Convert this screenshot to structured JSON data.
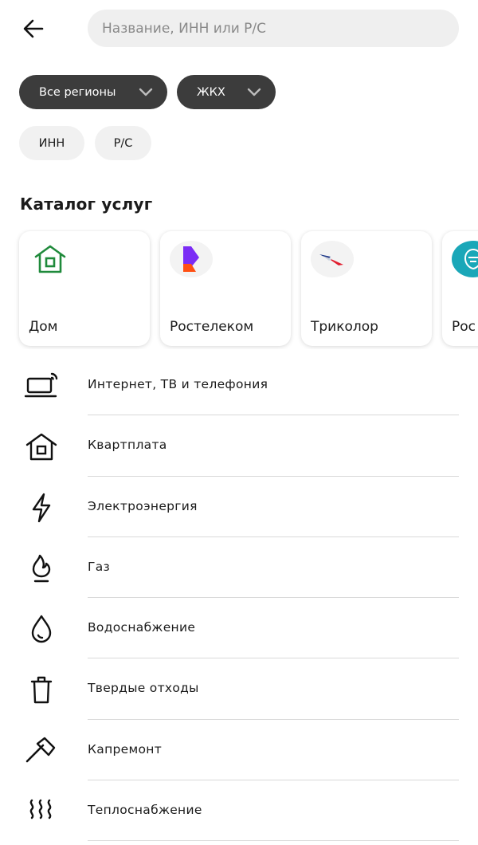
{
  "search": {
    "placeholder": "Название, ИНН или Р/С"
  },
  "filters": {
    "region_label": "Все регионы",
    "category_label": "ЖКХ",
    "inn_label": "ИНН",
    "rs_label": "Р/С"
  },
  "catalog": {
    "title": "Каталог услуг",
    "cards": [
      {
        "name": "Дом",
        "icon": "house-icon"
      },
      {
        "name": "Ростелеком",
        "icon": "rostelecom-logo"
      },
      {
        "name": "Триколор",
        "icon": "tricolor-logo"
      },
      {
        "name": "Рос",
        "icon": "emblem-logo"
      }
    ]
  },
  "services": [
    {
      "label": "Интернет, ТВ и телефония",
      "icon": "laptop-wifi-icon"
    },
    {
      "label": "Квартплата",
      "icon": "house-icon"
    },
    {
      "label": "Электроэнергия",
      "icon": "lightning-icon"
    },
    {
      "label": "Газ",
      "icon": "flame-icon"
    },
    {
      "label": "Водоснабжение",
      "icon": "water-drop-icon"
    },
    {
      "label": "Твердые отходы",
      "icon": "trash-icon"
    },
    {
      "label": "Капремонт",
      "icon": "hammer-icon"
    },
    {
      "label": "Теплоснабжение",
      "icon": "heat-icon"
    }
  ],
  "colors": {
    "chip_dark": "#3c3c3c",
    "chip_light": "#f1f1f1",
    "home_green": "#1f8a3b",
    "rostelecom_purple": "#7b2cf5",
    "rostelecom_orange": "#ff4f12"
  }
}
